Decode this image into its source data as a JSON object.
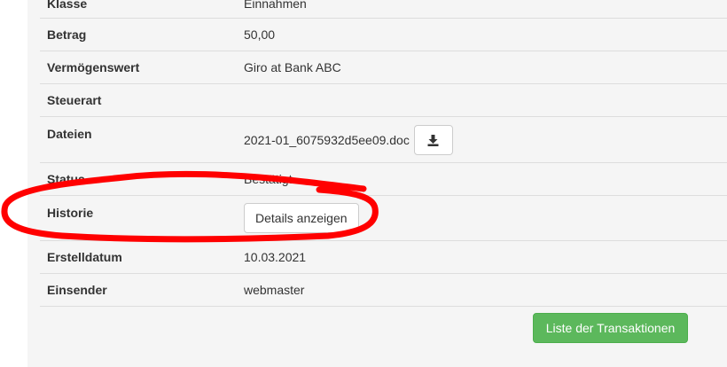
{
  "rows": [
    {
      "label": "Klasse",
      "value": "Einnahmen"
    },
    {
      "label": "Betrag",
      "value": "50,00"
    },
    {
      "label": "Vermögenswert",
      "value": "Giro at Bank ABC"
    },
    {
      "label": "Steuerart",
      "value": ""
    },
    {
      "label": "Dateien",
      "value": "2021-01_6075932d5ee09.doc"
    },
    {
      "label": "Status",
      "value": "Bestätigt"
    },
    {
      "label": "Historie",
      "value": "Details anzeigen"
    },
    {
      "label": "Erstelldatum",
      "value": "10.03.2021"
    },
    {
      "label": "Einsender",
      "value": "webmaster"
    }
  ],
  "icons": {
    "download": "download-icon"
  },
  "buttons": {
    "transactions_list": "Liste der Transaktionen"
  },
  "colors": {
    "success": "#5cb85c",
    "annotation": "#ff0000"
  }
}
